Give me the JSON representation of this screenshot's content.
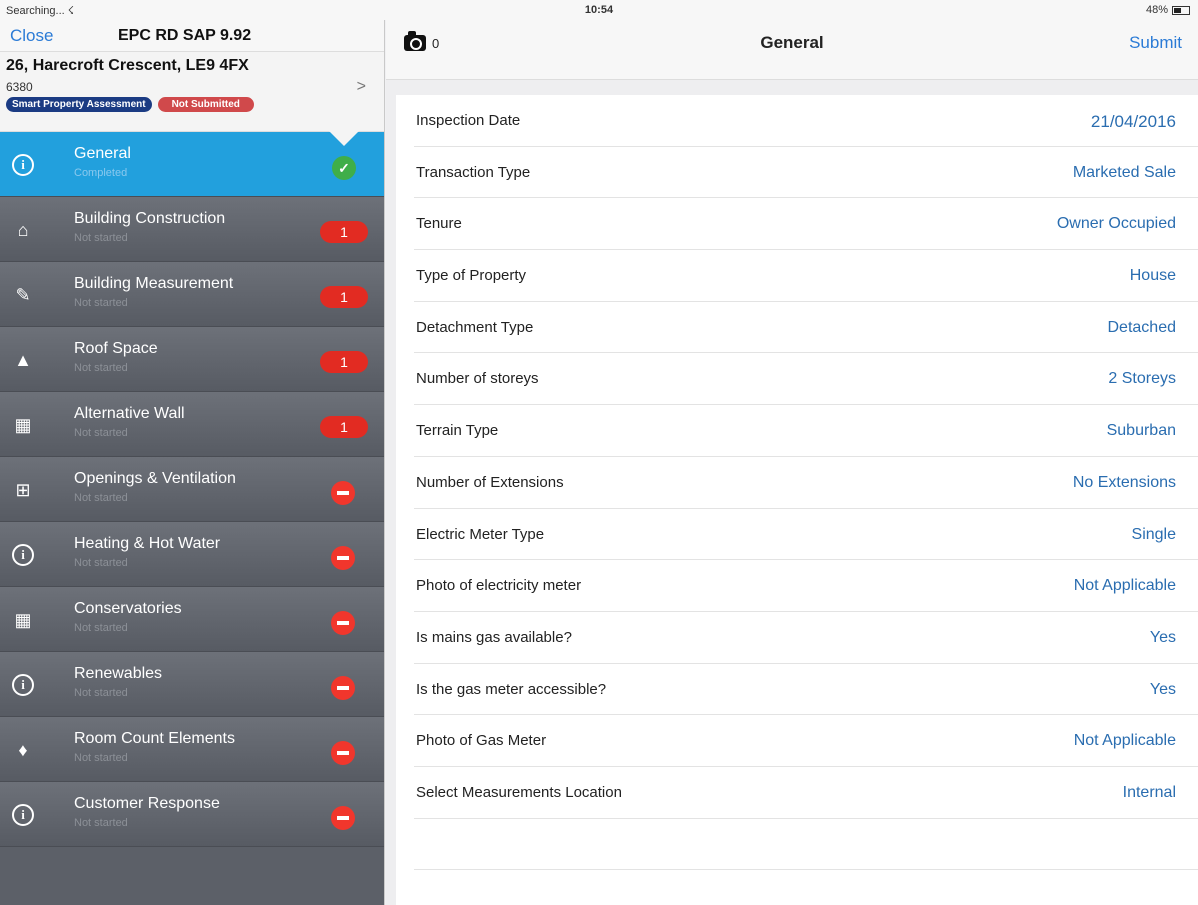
{
  "status_bar": {
    "carrier": "Searching... ☇",
    "time": "10:54",
    "battery": "48%",
    "battery_level": 0.48
  },
  "left_nav_bar": {
    "close_label": "Close",
    "title": "EPC RD SAP 9.92"
  },
  "property": {
    "address": "26, Harecroft Crescent, LE9 4FX",
    "id": "6380",
    "chevron": ">",
    "badge_assessment": "Smart Property Assessment",
    "badge_status": "Not Submitted"
  },
  "sections": [
    {
      "title": "General",
      "status": "Completed",
      "icon": "info-icon",
      "indicator": "check",
      "active": true
    },
    {
      "title": "Building Construction",
      "status": "Not started",
      "icon": "house-icon",
      "indicator": "count",
      "count": "1"
    },
    {
      "title": "Building Measurement",
      "status": "Not started",
      "icon": "ruler-icon",
      "indicator": "count",
      "count": "1"
    },
    {
      "title": "Roof Space",
      "status": "Not started",
      "icon": "roof-icon",
      "indicator": "count",
      "count": "1"
    },
    {
      "title": "Alternative Wall",
      "status": "Not started",
      "icon": "brick-wall-icon",
      "indicator": "count",
      "count": "1"
    },
    {
      "title": "Openings & Ventilation",
      "status": "Not started",
      "icon": "window-icon",
      "indicator": "minus"
    },
    {
      "title": "Heating & Hot Water",
      "status": "Not started",
      "icon": "info-icon",
      "indicator": "minus"
    },
    {
      "title": "Conservatories",
      "status": "Not started",
      "icon": "conservatory-icon",
      "indicator": "minus"
    },
    {
      "title": "Renewables",
      "status": "Not started",
      "icon": "info-icon",
      "indicator": "minus"
    },
    {
      "title": "Room Count Elements",
      "status": "Not started",
      "icon": "bulb-icon",
      "indicator": "minus"
    },
    {
      "title": "Customer Response",
      "status": "Not started",
      "icon": "info-icon",
      "indicator": "minus"
    }
  ],
  "right_nav_bar": {
    "photo_count": "0",
    "title": "General",
    "submit_label": "Submit"
  },
  "form": {
    "rows": [
      {
        "label": "Inspection Date",
        "value": "21/04/2016"
      },
      {
        "label": "Transaction Type",
        "value": "Marketed Sale"
      },
      {
        "label": "Tenure",
        "value": "Owner Occupied"
      },
      {
        "label": "Type of Property",
        "value": "House"
      },
      {
        "label": "Detachment Type",
        "value": "Detached"
      },
      {
        "label": "Number of storeys",
        "value": "2 Storeys"
      },
      {
        "label": "Terrain Type",
        "value": "Suburban"
      },
      {
        "label": "Number of Extensions",
        "value": "No Extensions"
      },
      {
        "label": "Electric Meter Type",
        "value": "Single"
      },
      {
        "label": "Photo of electricity meter",
        "value": "Not Applicable"
      },
      {
        "label": "Is mains gas available?",
        "value": "Yes"
      },
      {
        "label": "Is the gas meter accessible?",
        "value": "Yes"
      },
      {
        "label": "Photo of Gas Meter",
        "value": "Not Applicable"
      },
      {
        "label": "Select Measurements Location",
        "value": "Internal"
      }
    ]
  }
}
